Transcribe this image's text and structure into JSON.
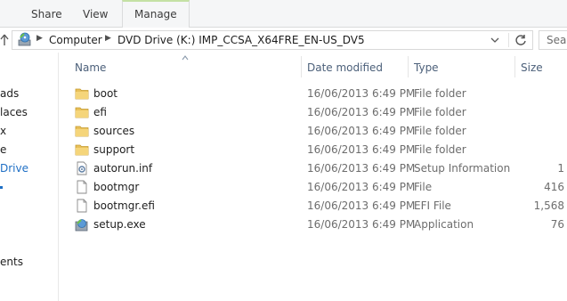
{
  "ribbon": {
    "tabs": [
      "Share",
      "View",
      "Manage"
    ],
    "accent_color": "#c4e1a4"
  },
  "address": {
    "crumbs": [
      "Computer",
      "DVD Drive (K:) IMP_CCSA_X64FRE_EN-US_DV5"
    ],
    "search_placeholder": "Sear"
  },
  "nav": {
    "items": [
      "ads",
      "laces",
      "x",
      "e",
      "Drive",
      "",
      "ents"
    ]
  },
  "columns": {
    "name": "Name",
    "date": "Date modified",
    "type": "Type",
    "size": "Size"
  },
  "files": [
    {
      "name": "boot",
      "date": "16/06/2013 6:49 PM",
      "type": "File folder",
      "size": "",
      "icon": "folder-icon"
    },
    {
      "name": "efi",
      "date": "16/06/2013 6:49 PM",
      "type": "File folder",
      "size": "",
      "icon": "folder-icon"
    },
    {
      "name": "sources",
      "date": "16/06/2013 6:49 PM",
      "type": "File folder",
      "size": "",
      "icon": "folder-icon"
    },
    {
      "name": "support",
      "date": "16/06/2013 6:49 PM",
      "type": "File folder",
      "size": "",
      "icon": "folder-icon"
    },
    {
      "name": "autorun.inf",
      "date": "16/06/2013 6:49 PM",
      "type": "Setup Information",
      "size": "1",
      "icon": "settings-file-icon"
    },
    {
      "name": "bootmgr",
      "date": "16/06/2013 6:49 PM",
      "type": "File",
      "size": "416",
      "icon": "file-icon"
    },
    {
      "name": "bootmgr.efi",
      "date": "16/06/2013 6:49 PM",
      "type": "EFI File",
      "size": "1,568",
      "icon": "file-icon"
    },
    {
      "name": "setup.exe",
      "date": "16/06/2013 6:49 PM",
      "type": "Application",
      "size": "76",
      "icon": "setup-app-icon"
    }
  ]
}
